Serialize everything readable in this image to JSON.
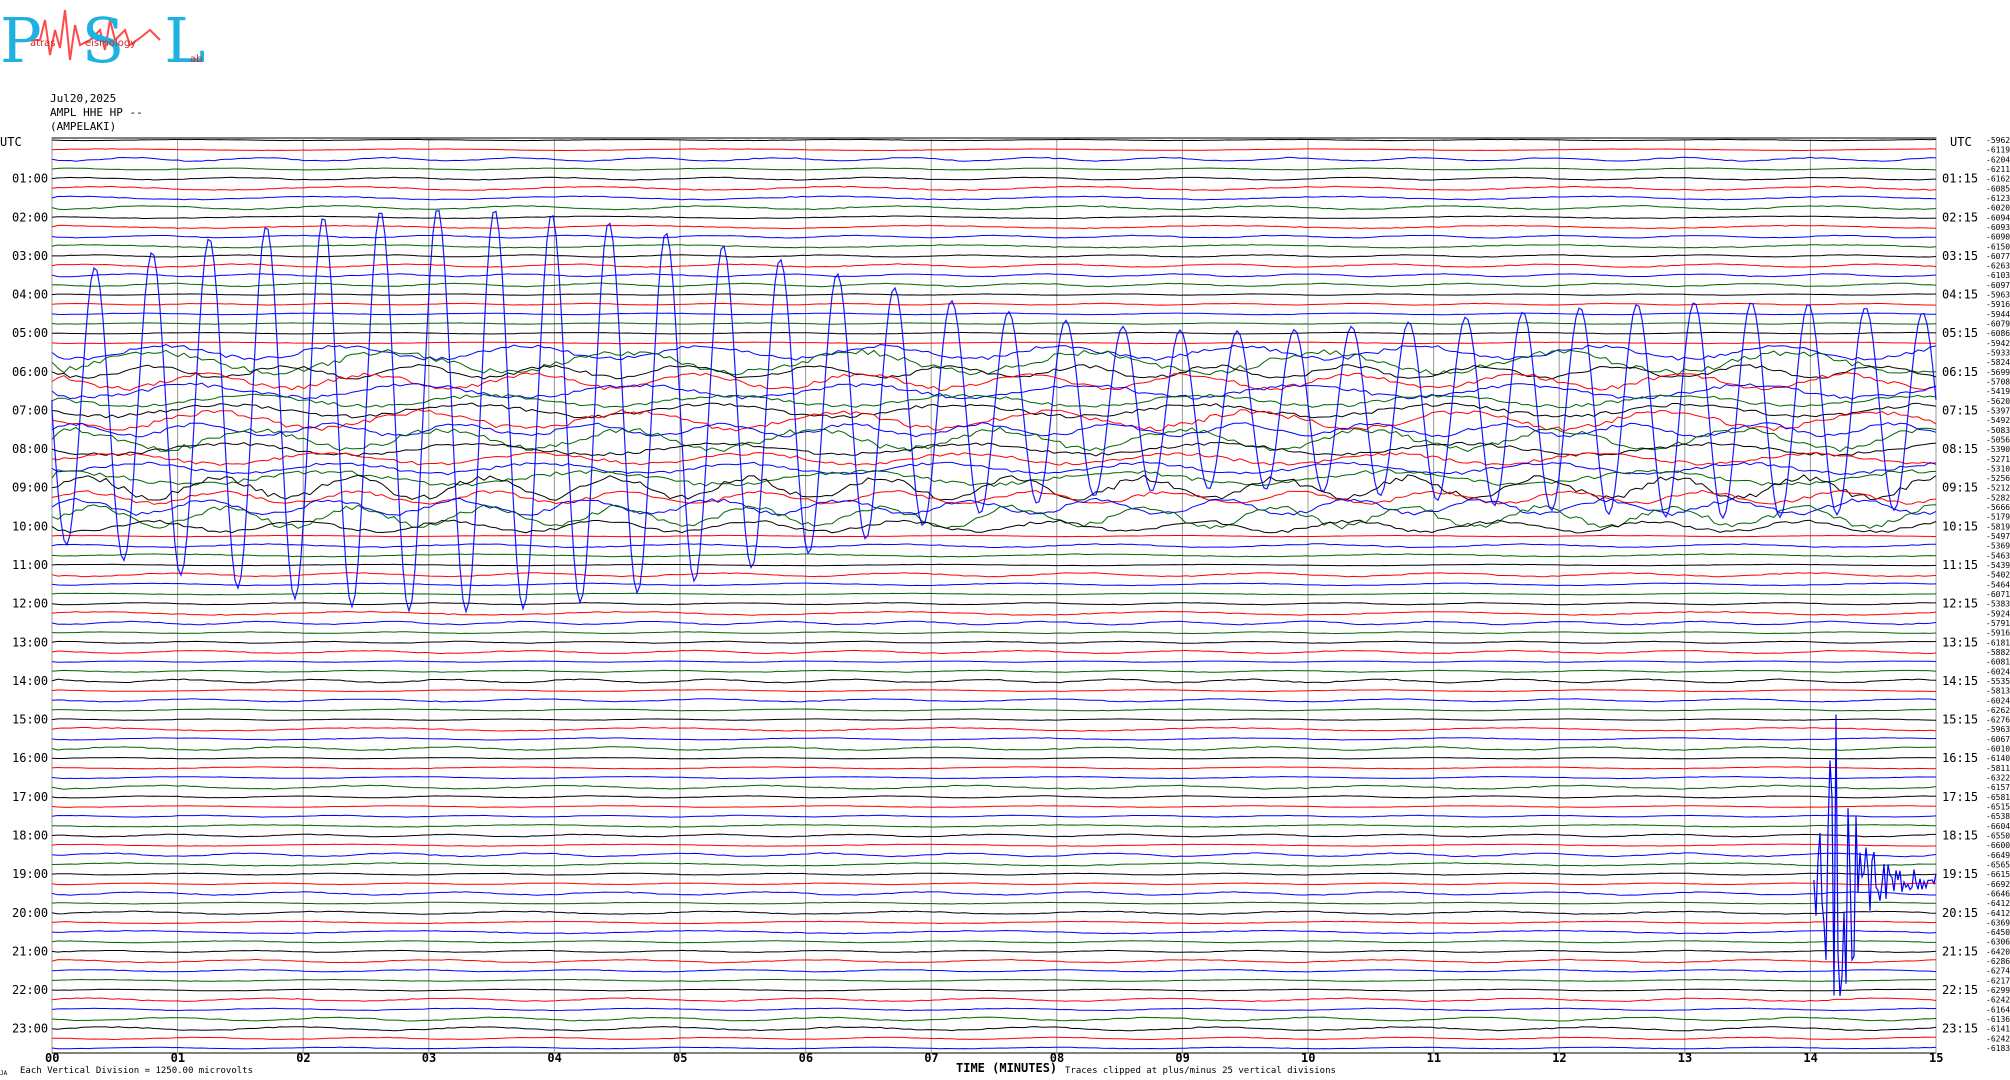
{
  "logo": {
    "letters": "PSL",
    "words": [
      "atras",
      "eismology",
      "ab"
    ]
  },
  "header": {
    "date": "Jul20,2025",
    "channel": "AMPL HHE HP --",
    "station": "(AMPELAKI)"
  },
  "chart_data": {
    "type": "line",
    "left_axis_title": "UTC",
    "right_axis_title": "UTC",
    "left_hour_labels": [
      "01:00",
      "02:00",
      "03:00",
      "04:00",
      "05:00",
      "06:00",
      "07:00",
      "08:00",
      "09:00",
      "10:00",
      "11:00",
      "12:00",
      "13:00",
      "14:00",
      "15:00",
      "16:00",
      "17:00",
      "18:00",
      "19:00",
      "20:00",
      "21:00",
      "22:00",
      "23:00"
    ],
    "right_hour_labels": [
      "01:15",
      "02:15",
      "03:15",
      "04:15",
      "05:15",
      "06:15",
      "07:15",
      "08:15",
      "09:15",
      "10:15",
      "11:15",
      "12:15",
      "13:15",
      "14:15",
      "15:15",
      "16:15",
      "17:15",
      "18:15",
      "19:15",
      "20:15",
      "21:15",
      "22:15",
      "23:15"
    ],
    "x_ticks": [
      "00",
      "01",
      "02",
      "03",
      "04",
      "05",
      "06",
      "07",
      "08",
      "09",
      "10",
      "11",
      "12",
      "13",
      "14",
      "15"
    ],
    "xlabel": "TIME (MINUTES)",
    "trace_colors": [
      "#000000",
      "#ff0000",
      "#0000ff",
      "#006400"
    ],
    "trace_offsets": [
      "-5962",
      "-6119",
      "-6204",
      "-6211",
      "-6162",
      "-6085",
      "-6123",
      "-6020",
      "-6094",
      "-6093",
      "-6090",
      "-6150",
      "-6077",
      "-6263",
      "-6103",
      "-6097",
      "-5963",
      "-5916",
      "-5944",
      "-6079",
      "-6086",
      "-5942",
      "-5933",
      "-5824",
      "-5699",
      "-5708",
      "-5419",
      "-5620",
      "-5397",
      "-5492",
      "-5083",
      "-5056",
      "-5390",
      "-5271",
      "-5310",
      "-5256",
      "-5212",
      "-5282",
      "-5666",
      "-5179",
      "-5819",
      "-5497",
      "-5369",
      "-5463",
      "-5439",
      "-5402",
      "-5464",
      "-6071",
      "-5383",
      "-5924",
      "-5791",
      "-5916",
      "-6181",
      "-5882",
      "-6081",
      "-6024",
      "-5535",
      "-5813",
      "-6024",
      "-6262",
      "-6276",
      "-5963",
      "-6067",
      "-6010",
      "-6140",
      "-5811",
      "-6322",
      "-6157",
      "-6581",
      "-6515",
      "-6538",
      "-6604",
      "-6550",
      "-6600",
      "-6649",
      "-6565",
      "-6615",
      "-6692",
      "-6646",
      "-6412",
      "-6412",
      "-6369",
      "-6450",
      "-6306",
      "-6420",
      "-6286",
      "-6274",
      "-6217",
      "-6299",
      "-6242",
      "-6164",
      "-6136",
      "-6141",
      "-6242",
      "-6183"
    ],
    "units_note": "Each Vertical Division = 1250.00 microvolts",
    "clip_note": "Traces clipped at plus/minus 25 vertical divisions",
    "corner_note": "JA"
  }
}
